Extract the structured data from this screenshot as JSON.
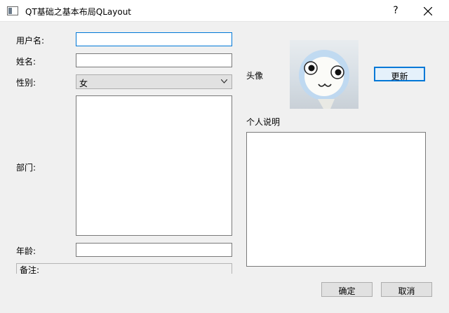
{
  "window": {
    "title": "QT基础之基本布局QLayout",
    "help_glyph": "?",
    "close_icon": "close-icon"
  },
  "form": {
    "username_label": "用户名:",
    "username_value": "",
    "name_label": "姓名:",
    "name_value": "",
    "gender_label": "性别:",
    "gender_value": "女",
    "department_label": "部门:",
    "department_value": "",
    "age_label": "年龄:",
    "age_value": "",
    "remarks_label": "备注:"
  },
  "profile": {
    "avatar_label": "头像",
    "update_button": "更新",
    "description_label": "个人说明",
    "description_value": ""
  },
  "actions": {
    "ok": "确定",
    "cancel": "取消"
  },
  "colors": {
    "focus": "#0078d7",
    "window_bg": "#f0f0f0",
    "titlebar_bg": "#ffffff"
  }
}
